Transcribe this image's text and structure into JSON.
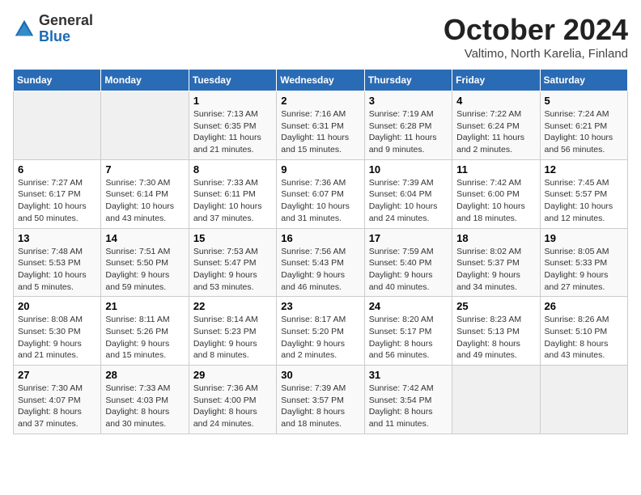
{
  "logo": {
    "general": "General",
    "blue": "Blue"
  },
  "title": "October 2024",
  "location": "Valtimo, North Karelia, Finland",
  "headers": [
    "Sunday",
    "Monday",
    "Tuesday",
    "Wednesday",
    "Thursday",
    "Friday",
    "Saturday"
  ],
  "weeks": [
    [
      {
        "day": "",
        "info": ""
      },
      {
        "day": "",
        "info": ""
      },
      {
        "day": "1",
        "info": "Sunrise: 7:13 AM\nSunset: 6:35 PM\nDaylight: 11 hours\nand 21 minutes."
      },
      {
        "day": "2",
        "info": "Sunrise: 7:16 AM\nSunset: 6:31 PM\nDaylight: 11 hours\nand 15 minutes."
      },
      {
        "day": "3",
        "info": "Sunrise: 7:19 AM\nSunset: 6:28 PM\nDaylight: 11 hours\nand 9 minutes."
      },
      {
        "day": "4",
        "info": "Sunrise: 7:22 AM\nSunset: 6:24 PM\nDaylight: 11 hours\nand 2 minutes."
      },
      {
        "day": "5",
        "info": "Sunrise: 7:24 AM\nSunset: 6:21 PM\nDaylight: 10 hours\nand 56 minutes."
      }
    ],
    [
      {
        "day": "6",
        "info": "Sunrise: 7:27 AM\nSunset: 6:17 PM\nDaylight: 10 hours\nand 50 minutes."
      },
      {
        "day": "7",
        "info": "Sunrise: 7:30 AM\nSunset: 6:14 PM\nDaylight: 10 hours\nand 43 minutes."
      },
      {
        "day": "8",
        "info": "Sunrise: 7:33 AM\nSunset: 6:11 PM\nDaylight: 10 hours\nand 37 minutes."
      },
      {
        "day": "9",
        "info": "Sunrise: 7:36 AM\nSunset: 6:07 PM\nDaylight: 10 hours\nand 31 minutes."
      },
      {
        "day": "10",
        "info": "Sunrise: 7:39 AM\nSunset: 6:04 PM\nDaylight: 10 hours\nand 24 minutes."
      },
      {
        "day": "11",
        "info": "Sunrise: 7:42 AM\nSunset: 6:00 PM\nDaylight: 10 hours\nand 18 minutes."
      },
      {
        "day": "12",
        "info": "Sunrise: 7:45 AM\nSunset: 5:57 PM\nDaylight: 10 hours\nand 12 minutes."
      }
    ],
    [
      {
        "day": "13",
        "info": "Sunrise: 7:48 AM\nSunset: 5:53 PM\nDaylight: 10 hours\nand 5 minutes."
      },
      {
        "day": "14",
        "info": "Sunrise: 7:51 AM\nSunset: 5:50 PM\nDaylight: 9 hours\nand 59 minutes."
      },
      {
        "day": "15",
        "info": "Sunrise: 7:53 AM\nSunset: 5:47 PM\nDaylight: 9 hours\nand 53 minutes."
      },
      {
        "day": "16",
        "info": "Sunrise: 7:56 AM\nSunset: 5:43 PM\nDaylight: 9 hours\nand 46 minutes."
      },
      {
        "day": "17",
        "info": "Sunrise: 7:59 AM\nSunset: 5:40 PM\nDaylight: 9 hours\nand 40 minutes."
      },
      {
        "day": "18",
        "info": "Sunrise: 8:02 AM\nSunset: 5:37 PM\nDaylight: 9 hours\nand 34 minutes."
      },
      {
        "day": "19",
        "info": "Sunrise: 8:05 AM\nSunset: 5:33 PM\nDaylight: 9 hours\nand 27 minutes."
      }
    ],
    [
      {
        "day": "20",
        "info": "Sunrise: 8:08 AM\nSunset: 5:30 PM\nDaylight: 9 hours\nand 21 minutes."
      },
      {
        "day": "21",
        "info": "Sunrise: 8:11 AM\nSunset: 5:26 PM\nDaylight: 9 hours\nand 15 minutes."
      },
      {
        "day": "22",
        "info": "Sunrise: 8:14 AM\nSunset: 5:23 PM\nDaylight: 9 hours\nand 8 minutes."
      },
      {
        "day": "23",
        "info": "Sunrise: 8:17 AM\nSunset: 5:20 PM\nDaylight: 9 hours\nand 2 minutes."
      },
      {
        "day": "24",
        "info": "Sunrise: 8:20 AM\nSunset: 5:17 PM\nDaylight: 8 hours\nand 56 minutes."
      },
      {
        "day": "25",
        "info": "Sunrise: 8:23 AM\nSunset: 5:13 PM\nDaylight: 8 hours\nand 49 minutes."
      },
      {
        "day": "26",
        "info": "Sunrise: 8:26 AM\nSunset: 5:10 PM\nDaylight: 8 hours\nand 43 minutes."
      }
    ],
    [
      {
        "day": "27",
        "info": "Sunrise: 7:30 AM\nSunset: 4:07 PM\nDaylight: 8 hours\nand 37 minutes."
      },
      {
        "day": "28",
        "info": "Sunrise: 7:33 AM\nSunset: 4:03 PM\nDaylight: 8 hours\nand 30 minutes."
      },
      {
        "day": "29",
        "info": "Sunrise: 7:36 AM\nSunset: 4:00 PM\nDaylight: 8 hours\nand 24 minutes."
      },
      {
        "day": "30",
        "info": "Sunrise: 7:39 AM\nSunset: 3:57 PM\nDaylight: 8 hours\nand 18 minutes."
      },
      {
        "day": "31",
        "info": "Sunrise: 7:42 AM\nSunset: 3:54 PM\nDaylight: 8 hours\nand 11 minutes."
      },
      {
        "day": "",
        "info": ""
      },
      {
        "day": "",
        "info": ""
      }
    ]
  ]
}
